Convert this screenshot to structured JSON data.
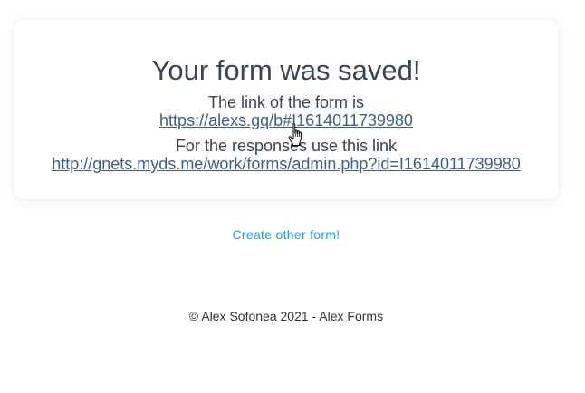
{
  "card": {
    "title": "Your form was saved!",
    "form_link_label": "The link of the form is",
    "form_link_url": "https://alexs.gq/b#I1614011739980",
    "responses_label": "For the responses use this link",
    "responses_link_url": "http://gnets.myds.me/work/forms/admin.php?id=I1614011739980"
  },
  "create_other_label": "Create other form!",
  "footer": {
    "copyright": "© Alex Sofonea 2021 - Alex Forms"
  },
  "icons": {
    "cursor": "hand-pointer-icon"
  }
}
